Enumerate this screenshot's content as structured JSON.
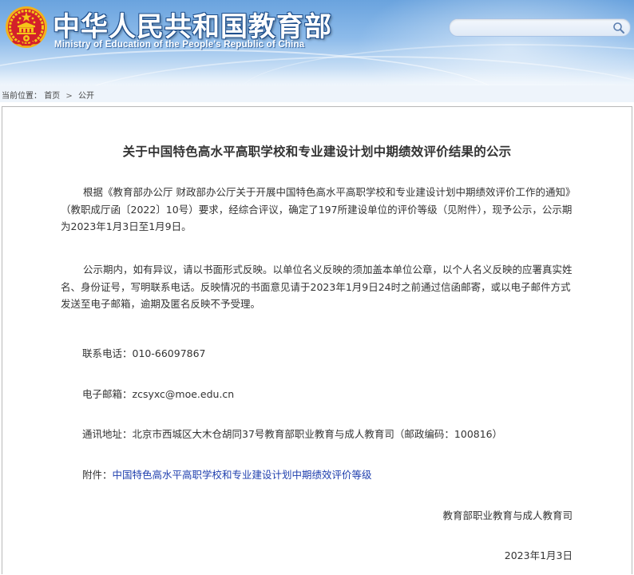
{
  "header": {
    "title": "中华人民共和国教育部",
    "subtitle": "Ministry of Education of the People's Republic of China",
    "search_placeholder": ""
  },
  "breadcrumb": {
    "prefix": "当前位置：",
    "items": [
      "首页",
      "公开"
    ],
    "separator": ">"
  },
  "article": {
    "title": "关于中国特色高水平高职学校和专业建设计划中期绩效评价结果的公示",
    "paragraphs": [
      "根据《教育部办公厅 财政部办公厅关于开展中国特色高水平高职学校和专业建设计划中期绩效评价工作的通知》（教职成厅函〔2022〕10号）要求，经综合评议，确定了197所建设单位的评价等级（见附件），现予公示，公示期为2023年1月3日至1月9日。",
      "公示期内，如有异议，请以书面形式反映。以单位名义反映的须加盖本单位公章，以个人名义反映的应署真实姓名、身份证号，写明联系电话。反映情况的书面意见请于2023年1月9日24时之前通过信函邮寄，或以电子邮件方式发送至电子邮箱，逾期及匿名反映不予受理。"
    ],
    "phone_label": "联系电话：",
    "phone_value": "010-66097867",
    "email_label": "电子邮箱：",
    "email_value": "zcsyxc@moe.edu.cn",
    "address_label": "通讯地址：",
    "address_value": "北京市西城区大木仓胡同37号教育部职业教育与成人教育司（邮政编码：100816）",
    "attachment_label": "附件：",
    "attachment_link": "中国特色高水平高职学校和专业建设计划中期绩效评价等级",
    "signature_org": "教育部职业教育与成人教育司",
    "signature_date": "2023年1月3日"
  },
  "colors": {
    "banner_top": "#6aa3de",
    "title_outline": "#1e4f8d",
    "link": "#1f3fae",
    "emblem_red": "#d3202a",
    "emblem_gold": "#f5c518"
  },
  "icons": {
    "emblem": "national-emblem-icon",
    "search": "search-icon"
  }
}
